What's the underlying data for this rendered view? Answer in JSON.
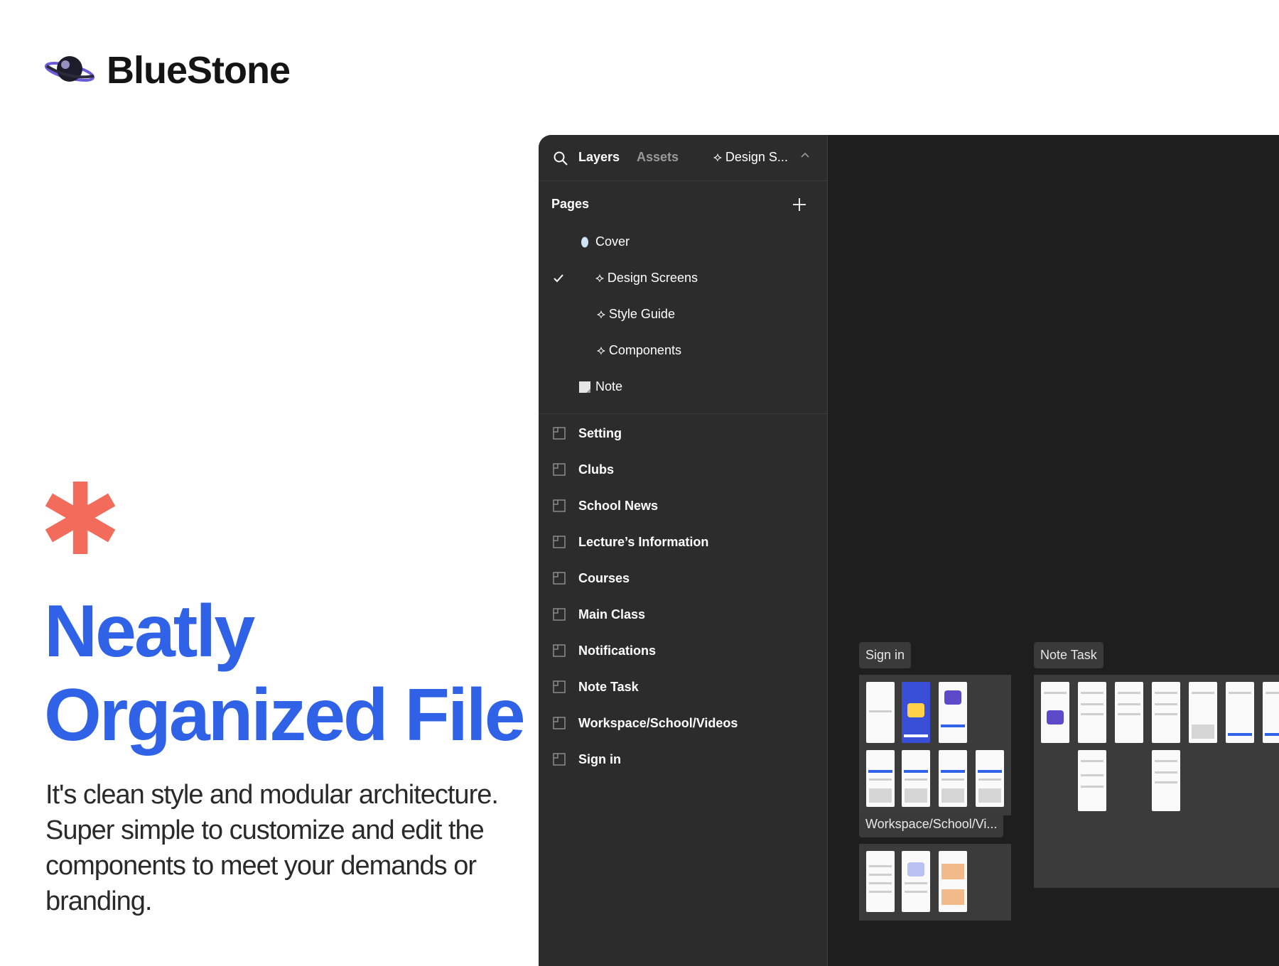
{
  "brand": {
    "name": "BlueStone",
    "logo_icon": "planet-logo-icon"
  },
  "hero": {
    "icon": "asterisk-icon",
    "accent_color": "#f26b5b",
    "headline_line1": "Neatly",
    "headline_line2": "Organized File",
    "headline_color": "#2f62e6",
    "description": "It's clean style and modular architecture. Super simple to customize and edit the components to meet your demands or branding."
  },
  "app": {
    "tabs": {
      "search_icon": "search-icon",
      "layers": "Layers",
      "assets": "Assets",
      "current_page": "⟡ Design S...",
      "chevron_icon": "chevron-up-icon"
    },
    "pages": {
      "title": "Pages",
      "add_icon": "plus-icon",
      "items": [
        {
          "label": "Cover",
          "icon": "oval-icon",
          "selected": false
        },
        {
          "label": "⟡ Design Screens",
          "icon": "",
          "selected": true
        },
        {
          "label": "⟡ Style Guide",
          "icon": "",
          "selected": false
        },
        {
          "label": "⟡ Components",
          "icon": "",
          "selected": false
        },
        {
          "label": "Note",
          "icon": "note-icon",
          "selected": false
        }
      ]
    },
    "layers": [
      "Setting",
      "Clubs",
      "School News",
      "Lecture’s Information",
      "Courses",
      "Main Class",
      "Notifications",
      "Note Task",
      "Workspace/School/Videos",
      "Sign in"
    ],
    "canvas": {
      "frames": [
        {
          "label": "Sign in"
        },
        {
          "label": "Note Task"
        },
        {
          "label": "Workspace/School/Vi..."
        }
      ]
    }
  }
}
